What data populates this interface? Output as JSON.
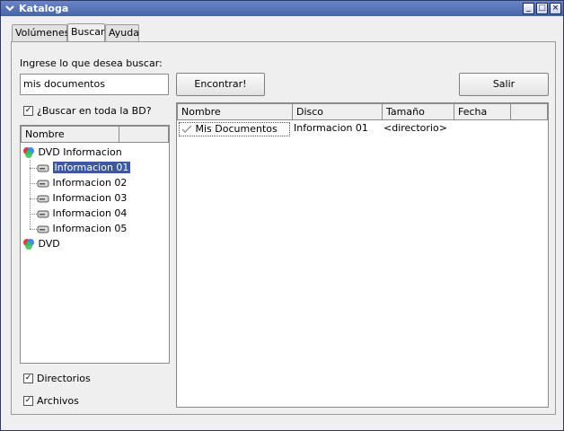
{
  "window": {
    "title": "Kataloga"
  },
  "tabs": [
    {
      "label": "Volúmenes",
      "active": false
    },
    {
      "label": "Buscar",
      "active": true
    },
    {
      "label": "Ayuda",
      "active": false
    }
  ],
  "search": {
    "prompt": "Ingrese lo que desea buscar:",
    "value": "mis documentos",
    "find_label": "Encontrar!",
    "exit_label": "Salir",
    "whole_db_label": "¿Buscar en toda la BD?",
    "whole_db_checked": true
  },
  "tree": {
    "header": "Nombre",
    "nodes": [
      {
        "label": "DVD Informacion",
        "icon": "dvd-icon"
      },
      {
        "label": "Informacion 01",
        "icon": "drive-icon",
        "selected": true
      },
      {
        "label": "Informacion 02",
        "icon": "drive-icon"
      },
      {
        "label": "Informacion 03",
        "icon": "drive-icon"
      },
      {
        "label": "Informacion 04",
        "icon": "drive-icon"
      },
      {
        "label": "Informacion 05",
        "icon": "drive-icon"
      },
      {
        "label": "DVD",
        "icon": "dvd-icon"
      }
    ]
  },
  "filters": {
    "directories_label": "Directorios",
    "directories_checked": true,
    "files_label": "Archivos",
    "files_checked": true
  },
  "results": {
    "columns": [
      "Nombre",
      "Disco",
      "Tamaño",
      "Fecha"
    ],
    "rows": [
      {
        "name": "Mis Documentos",
        "disk": "Informacion 01",
        "size": "<directorio>",
        "date": ""
      }
    ]
  },
  "colors": {
    "titlebar": "#5670b5",
    "selection": "#3d58a2"
  }
}
